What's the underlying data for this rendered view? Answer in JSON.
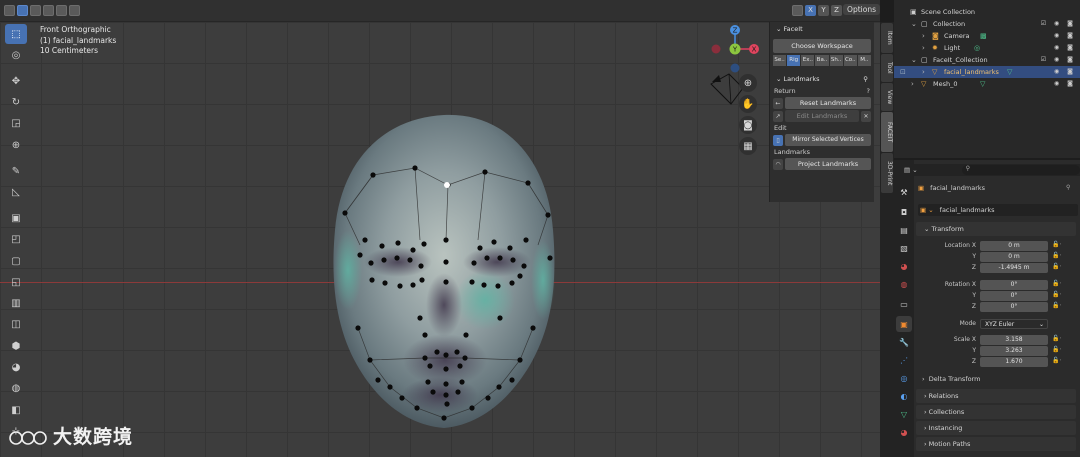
{
  "viewport": {
    "view_name": "Front Orthographic",
    "object_info": "(1) facial_landmarks",
    "scale_info": "10 Centimeters",
    "options_label": "Options",
    "axis_buttons": [
      "X",
      "Y",
      "Z"
    ]
  },
  "toolbar": {
    "tools": [
      "select-box",
      "cursor",
      "move",
      "rotate",
      "scale",
      "transform",
      "annotate",
      "measure",
      "add-cube",
      "extrude",
      "inset",
      "bevel",
      "loop-cut",
      "knife",
      "poly-build",
      "spin",
      "smooth",
      "shrink-fatten",
      "shear",
      "rip"
    ]
  },
  "gizmo": {
    "x_label": "X",
    "y_label": "Y",
    "z_label": "Z"
  },
  "n_panel": {
    "facelt_header": "FaceIt",
    "choose_workspace": "Choose Workspace",
    "workspace_tabs": [
      "Se..",
      "Rig",
      "Ex..",
      "Ba..",
      "Sh..",
      "Co..",
      "M.."
    ],
    "landmarks_header": "Landmarks",
    "return_label": "Return",
    "reset_landmarks": "Reset Landmarks",
    "edit_landmarks": "Edit Landmarks",
    "edit_label": "Edit",
    "mirror_selected": "Mirror Selected Vertices",
    "landmarks_label": "Landmarks",
    "project_landmarks": "Project Landmarks"
  },
  "vertical_tabs": [
    "Item",
    "Tool",
    "View",
    "FACEIT",
    "3D-Print"
  ],
  "outliner": {
    "rows": [
      {
        "label": "Scene Collection",
        "indent": 0
      },
      {
        "label": "Collection",
        "indent": 1
      },
      {
        "label": "Camera",
        "indent": 2
      },
      {
        "label": "Light",
        "indent": 2
      },
      {
        "label": "FaceIt_Collection",
        "indent": 1
      },
      {
        "label": "facial_landmarks",
        "indent": 2
      },
      {
        "label": "Mesh_0",
        "indent": 1
      }
    ]
  },
  "properties": {
    "object_name": "facial_landmarks",
    "data_name": "facial_landmarks",
    "transform_header": "Transform",
    "location_label": "Location X",
    "location": [
      "0 m",
      "0 m",
      "-1.4945 m"
    ],
    "rotation_label": "Rotation X",
    "rotation": [
      "0°",
      "0°",
      "0°"
    ],
    "mode_label": "Mode",
    "mode_value": "XYZ Euler",
    "scale_label": "Scale X",
    "scale": [
      "3.158",
      "3.263",
      "1.670"
    ],
    "axis_y": "Y",
    "axis_z": "Z",
    "delta_transform": "Delta Transform",
    "sections": [
      "Relations",
      "Collections",
      "Instancing",
      "Motion Paths"
    ]
  },
  "watermark": {
    "text": "大数跨境"
  },
  "colors": {
    "accent": "#4772b3",
    "selected_row": "#334d80",
    "x_axis": "#8c3a3a",
    "landmark": "#0a0a0a"
  }
}
